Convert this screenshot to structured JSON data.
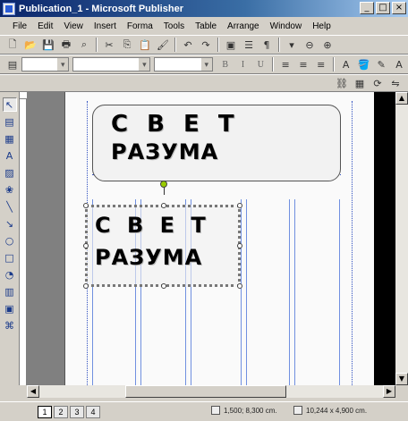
{
  "window": {
    "title": "Publication_1 - Microsoft Publisher",
    "minimize": "_",
    "maximize": "□",
    "close": "×"
  },
  "menu": {
    "items": [
      "File",
      "Edit",
      "View",
      "Insert",
      "Forma",
      "Tools",
      "Table",
      "Arrange",
      "Window",
      "Help"
    ]
  },
  "toolbar2": {
    "bold": "B",
    "italic": "I",
    "underline": "U"
  },
  "document": {
    "heading_line1": "С В Е Т",
    "heading_line2": "РАЗУМА"
  },
  "pages": [
    "1",
    "2",
    "3",
    "4"
  ],
  "status": {
    "position": "1,500; 8,300 cm.",
    "size": "10,244 x 4,900 cm."
  },
  "colors": {
    "titlebar_start": "#0a246a",
    "titlebar_end": "#a6caf0",
    "guides": "#3050c0",
    "rotation_handle": "#99cc00"
  },
  "icons": {
    "toolbar": [
      "new-icon",
      "open-icon",
      "save-icon",
      "print-icon",
      "preview-icon",
      "cut-icon",
      "copy-icon",
      "paste-icon",
      "format-painter-icon",
      "undo-icon",
      "zoom-out-icon",
      "zoom-in-icon"
    ],
    "palette": [
      "pointer-icon",
      "text-box-icon",
      "table-icon",
      "wordart-icon",
      "picture-icon",
      "clip-art-icon",
      "line-icon",
      "arrow-icon",
      "oval-icon",
      "rectangle-icon",
      "autoshapes-icon",
      "design-gallery-icon",
      "hot-spot-icon",
      "object-icon"
    ]
  }
}
